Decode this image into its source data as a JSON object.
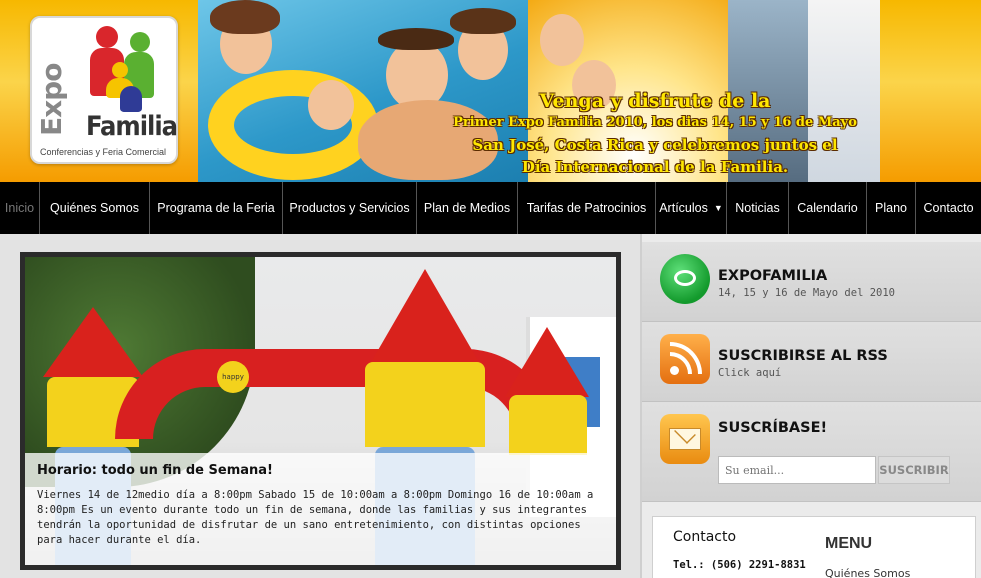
{
  "logo": {
    "line1": "Expo",
    "line2": "Familia",
    "tagline": "Conferencias y Feria Comercial"
  },
  "banner": {
    "line1": "Venga y disfrute de la",
    "line2": "Primer Expo Familia 2010, los dias 14, 15 y 16 de Mayo",
    "line3": "San José, Costa Rica y celebremos juntos el",
    "line4": "Día Internacional de la Familia."
  },
  "nav": {
    "items": [
      {
        "label": "Inicio"
      },
      {
        "label": "Quiénes Somos"
      },
      {
        "label": "Programa de la Feria"
      },
      {
        "label": "Productos y Servicios"
      },
      {
        "label": "Plan de Medios"
      },
      {
        "label": "Tarifas de Patrocinios"
      },
      {
        "label": "Artículos"
      },
      {
        "label": "Noticias"
      },
      {
        "label": "Calendario"
      },
      {
        "label": "Plano"
      },
      {
        "label": "Contacto"
      }
    ],
    "dropdown_icon": "caret-down-icon"
  },
  "feature": {
    "title": "Horario: todo un fin de Semana!",
    "body": "Viernes 14 de 12medio día a 8:00pm Sabado 15 de 10:00am a 8:00pm Domingo 16 de 10:00am a 8:00pm Es un evento durante todo un fin de semana, donde las familias y sus integrantes tendrán la oportunidad de disfrutar de un sano entretenimiento, con distintas opciones para hacer durante el día.",
    "balloon_text": "happy"
  },
  "sidebar": {
    "expofamilia": {
      "title": "EXPOFAMILIA",
      "subtitle": "14, 15 y 16 de Mayo del 2010",
      "icon": "chat-bubble-icon"
    },
    "rss": {
      "title": "SUSCRIBIRSE AL RSS",
      "subtitle": "Click aquí",
      "icon": "rss-icon"
    },
    "subscribe": {
      "title": "SUSCRÍBASE!",
      "placeholder": "Su email...",
      "button": "SUSCRIBIR",
      "icon": "envelope-icon"
    },
    "contact": {
      "title": "Contacto",
      "phone": "Tel.: (506) 2291-8831"
    },
    "menu": {
      "title": "MENU",
      "first_item": "Quiénes Somos"
    }
  },
  "colors": {
    "nav_bg": "#000000",
    "banner_yellow": "#f7b800",
    "rss_orange": "#f08a1c",
    "chat_green": "#1fa83a"
  }
}
